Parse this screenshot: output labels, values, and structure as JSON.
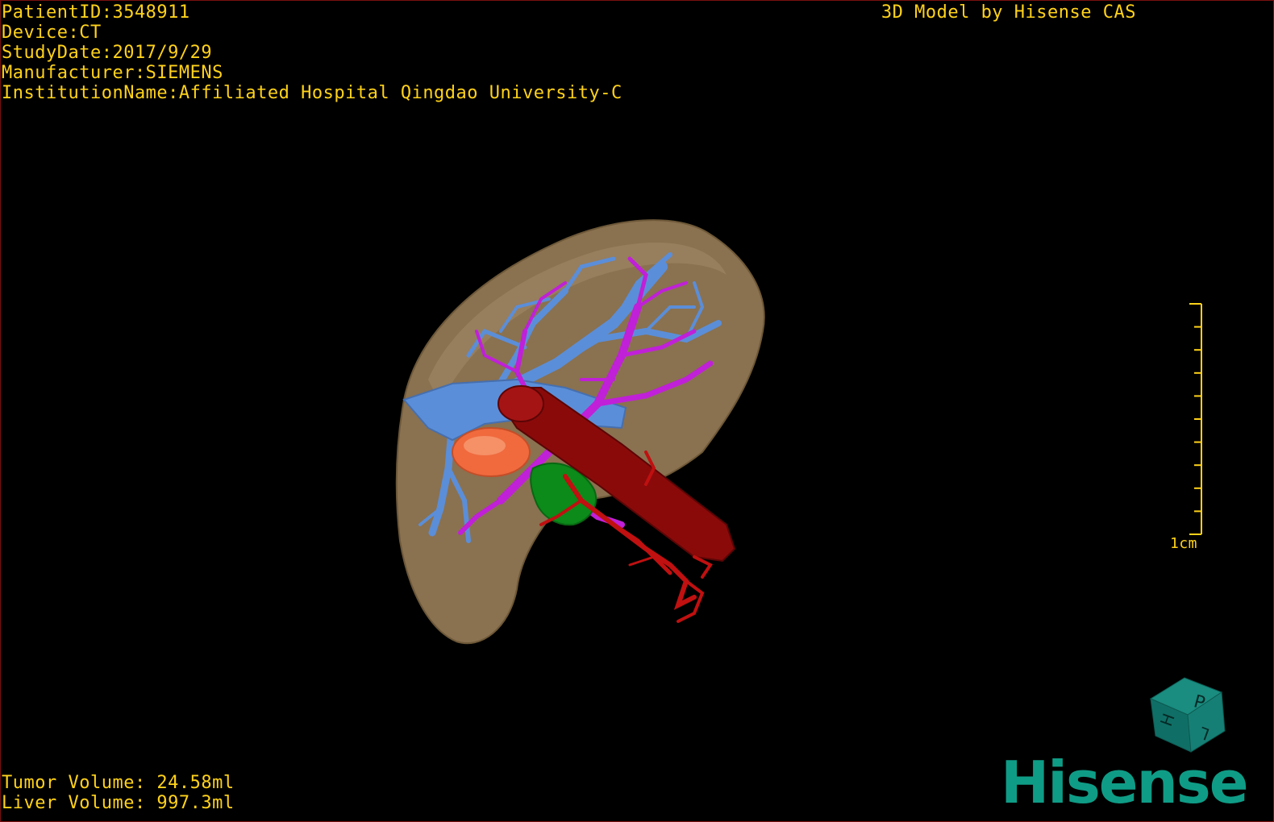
{
  "patient": {
    "patient_id": "PatientID:3548911",
    "device": "Device:CT",
    "study_date": "StudyDate:2017/9/29",
    "manufacturer": "Manufacturer:SIEMENS",
    "institution": "InstitutionName:Affiliated Hospital Qingdao University-C"
  },
  "title": "3D Model by Hisense CAS",
  "volumes": {
    "tumor": "Tumor Volume: 24.58ml",
    "liver": "Liver Volume: 997.3ml"
  },
  "scale_bar": {
    "label": "1cm"
  },
  "orientation_cube": {
    "labels": [
      "P",
      "H",
      "L"
    ]
  },
  "brand": {
    "logo_text": "Hisense"
  },
  "colors": {
    "overlay_text": "#ffd21a",
    "liver": "#8a7150",
    "hepatic_vein": "#5b8ed8",
    "portal_vein": "#c020d8",
    "vena_cava": "#8a0a0a",
    "artery": "#c01010",
    "tumor": "#f06a3e",
    "gallbladder": "#0c8a1a",
    "brand": "#0f9c86"
  }
}
